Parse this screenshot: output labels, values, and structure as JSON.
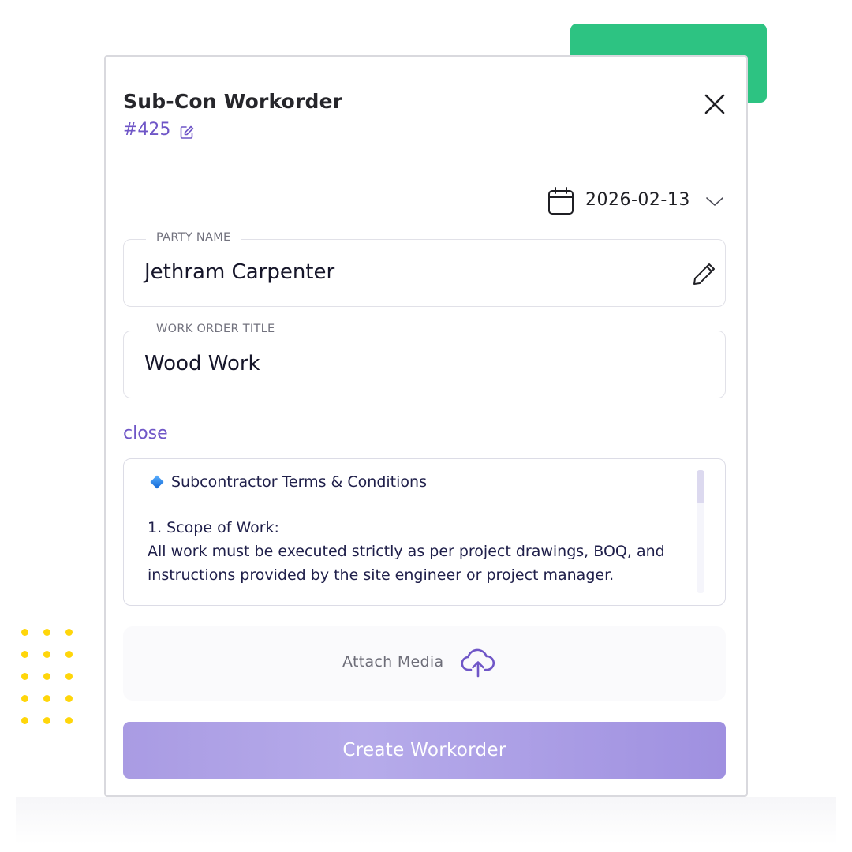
{
  "modal": {
    "title": "Sub-Con Workorder",
    "order_number": "#425",
    "date": "2026-02-13"
  },
  "fields": {
    "party_name": {
      "label": "PARTY NAME",
      "value": "Jethram Carpenter"
    },
    "work_order_title": {
      "label": "WORK ORDER TITLE",
      "value": "Wood Work"
    }
  },
  "terms": {
    "toggle_label": "close",
    "heading": "Subcontractor Terms & Conditions",
    "lines": [
      "1. Scope of Work:",
      "All work must be executed strictly as per project drawings, BOQ, and",
      "instructions provided by the site engineer or project manager."
    ]
  },
  "attach": {
    "label": "Attach Media"
  },
  "actions": {
    "create_label": "Create Workorder"
  },
  "colors": {
    "accent": "#6f56c7",
    "decor_green": "#2dc382",
    "decor_yellow": "#ffd60a",
    "button": "#a99be3"
  },
  "icons": [
    "edit-icon",
    "close-icon",
    "calendar-icon",
    "chevron-down-icon",
    "pencil-icon",
    "diamond-icon",
    "upload-cloud-icon"
  ]
}
